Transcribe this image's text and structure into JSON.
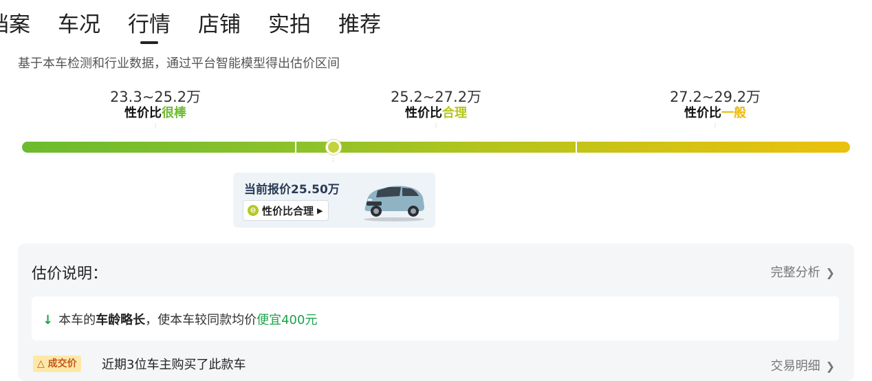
{
  "tabs": [
    {
      "label": "档案",
      "active": false
    },
    {
      "label": "车况",
      "active": false
    },
    {
      "label": "行情",
      "active": true
    },
    {
      "label": "店铺",
      "active": false
    },
    {
      "label": "实拍",
      "active": false
    },
    {
      "label": "推荐",
      "active": false
    }
  ],
  "subtitle": "基于本车检测和行业数据，通过平台智能模型得出估价区间",
  "ranges": [
    {
      "value": "23.3~25.2万",
      "prefix": "性价比",
      "rating": "很棒",
      "color": "#6cbb2e"
    },
    {
      "value": "25.2~27.2万",
      "prefix": "性价比",
      "rating": "合理",
      "color": "#b7c61a"
    },
    {
      "value": "27.2~29.2万",
      "prefix": "性价比",
      "rating": "一般",
      "color": "#ebb90a"
    }
  ],
  "current_price": {
    "label": "当前报价25.50万",
    "rating_label": "性价比合理",
    "chip_icon": "smile-icon"
  },
  "panel": {
    "title": "估价说明：",
    "full_analysis": "完整分析",
    "detail": {
      "prefix": "本车的",
      "emphasis": "车龄略长",
      "middle": "，使本车较同款均价",
      "highlight": "便宜400元"
    },
    "deal_tag": "成交价",
    "deal_text": "近期3位车主购买了此款车",
    "deal_link": "交易明细"
  },
  "colors": {
    "green": "#1ca34a",
    "accent_text": "#2a3b55",
    "deal_tag_bg": "#fde8a8"
  }
}
